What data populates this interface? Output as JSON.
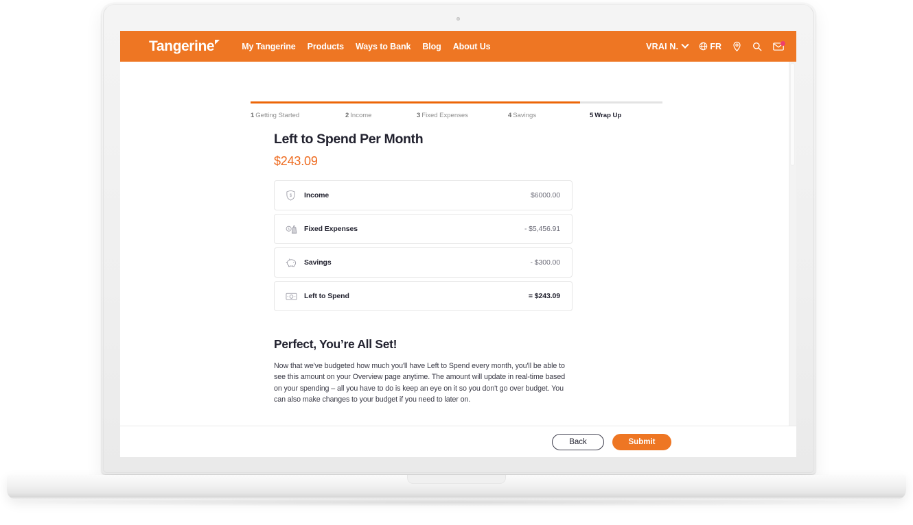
{
  "header": {
    "brand": "Tangerine",
    "nav": [
      {
        "label": "My Tangerine"
      },
      {
        "label": "Products"
      },
      {
        "label": "Ways to Bank"
      },
      {
        "label": "Blog"
      },
      {
        "label": "About Us"
      }
    ],
    "user_name": "VRAI N.",
    "language": "FR",
    "icons": [
      "globe-icon",
      "location-pin-icon",
      "search-icon",
      "envelope-icon"
    ],
    "background_color": "#EE7623"
  },
  "stepper": {
    "progress_percent": 80,
    "steps": [
      {
        "number": "1",
        "label": "Getting Started",
        "active": false
      },
      {
        "number": "2",
        "label": "Income",
        "active": false
      },
      {
        "number": "3",
        "label": "Fixed Expenses",
        "active": false
      },
      {
        "number": "4",
        "label": "Savings",
        "active": false
      },
      {
        "number": "5",
        "label": "Wrap Up",
        "active": true
      }
    ]
  },
  "page": {
    "title": "Left to Spend Per Month",
    "amount": "$243.09",
    "amount_color": "#EE6A1E",
    "summary": [
      {
        "icon": "shield-dollar-icon",
        "label": "Income",
        "value": "$6000.00"
      },
      {
        "icon": "coins-bag-icon",
        "label": "Fixed Expenses",
        "value": "- $5,456.91"
      },
      {
        "icon": "piggy-bank-icon",
        "label": "Savings",
        "value": "- $300.00"
      },
      {
        "icon": "banknote-icon",
        "label": "Left to Spend",
        "value": "= $243.09"
      }
    ],
    "section_heading": "Perfect, You’re All Set!",
    "section_paragraph": "Now that we've budgeted how much you'll have Left to Spend every month, you'll be able to see this amount on your Overview page anytime. The amount will update in real-time based on your spending – all you have to do is keep an eye on it so you don't go over budget. You can also make changes to your budget if you need to later on."
  },
  "footer": {
    "back_label": "Back",
    "submit_label": "Submit",
    "submit_color": "#EE7623"
  }
}
